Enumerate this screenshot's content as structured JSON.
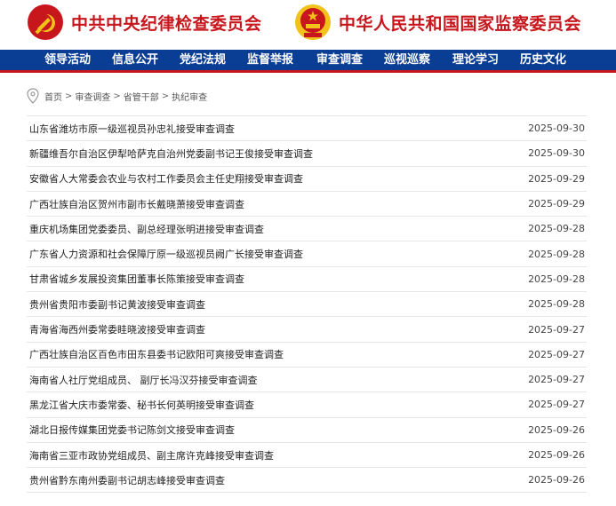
{
  "header": {
    "left_title": "中共中央纪律检查委员会",
    "right_title": "中华人民共和国国家监察委员会"
  },
  "nav": {
    "items": [
      "领导活动",
      "信息公开",
      "党纪法规",
      "监督举报",
      "审查调查",
      "巡视巡察",
      "理论学习",
      "历史文化"
    ]
  },
  "breadcrumb": {
    "items": [
      "首页",
      "审查调查",
      "省管干部",
      "执纪审查"
    ],
    "separator": ">"
  },
  "articles": [
    {
      "title": "山东省潍坊市原一级巡视员孙忠礼接受审查调查",
      "date": "2025-09-30"
    },
    {
      "title": "新疆维吾尔自治区伊犁哈萨克自治州党委副书记王俊接受审查调查",
      "date": "2025-09-30"
    },
    {
      "title": "安徽省人大常委会农业与农村工作委员会主任史翔接受审查调查",
      "date": "2025-09-29"
    },
    {
      "title": "广西壮族自治区贺州市副市长戴晓萧接受审查调查",
      "date": "2025-09-29"
    },
    {
      "title": "重庆机场集团党委委员、副总经理张明进接受审查调查",
      "date": "2025-09-28"
    },
    {
      "title": "广东省人力资源和社会保障厅原一级巡视员阙广长接受审查调查",
      "date": "2025-09-28"
    },
    {
      "title": "甘肃省城乡发展投资集团董事长陈策接受审查调查",
      "date": "2025-09-28"
    },
    {
      "title": "贵州省贵阳市委副书记黄波接受审查调查",
      "date": "2025-09-28"
    },
    {
      "title": "青海省海西州委常委眭晓波接受审查调查",
      "date": "2025-09-27"
    },
    {
      "title": "广西壮族自治区百色市田东县委书记欧阳可爽接受审查调查",
      "date": "2025-09-27"
    },
    {
      "title": "海南省人社厅党组成员、 副厅长冯汉芬接受审查调查",
      "date": "2025-09-27"
    },
    {
      "title": "黑龙江省大庆市委常委、秘书长何英明接受审查调查",
      "date": "2025-09-27"
    },
    {
      "title": "湖北日报传媒集团党委书记陈剑文接受审查调查",
      "date": "2025-09-26"
    },
    {
      "title": "海南省三亚市政协党组成员、副主席许克峰接受审查调查",
      "date": "2025-09-26"
    },
    {
      "title": "贵州省黔东南州委副书记胡志峰接受审查调查",
      "date": "2025-09-26"
    }
  ],
  "colors": {
    "brand_red": "#c8161d",
    "nav_blue": "#0a3d94",
    "emblem_gold": "#f2c11a"
  }
}
